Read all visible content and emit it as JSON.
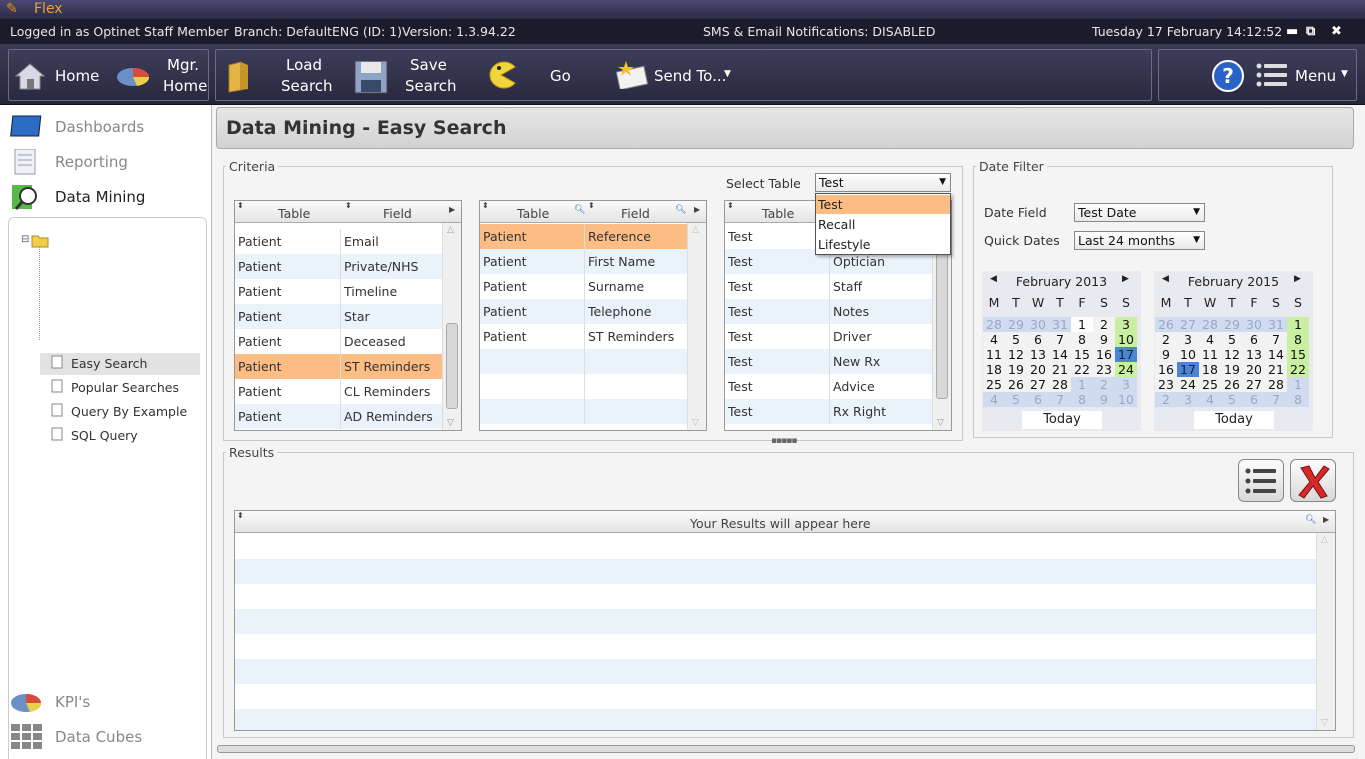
{
  "window": {
    "app_name": "Flex",
    "minimize": "▬",
    "restore": "⧉",
    "close": "✖"
  },
  "status": {
    "logged_in": "Logged in as Optinet Staff Member",
    "branch": "Branch: DefaultENG (ID:  1)",
    "version": "Version: 1.3.94.22",
    "notifications": "SMS & Email Notifications: DISABLED",
    "datetime": "Tuesday 17 February 14:12:52"
  },
  "toolbar": {
    "home": "Home",
    "mgr_home_1": "Mgr.",
    "mgr_home_2": "Home",
    "load_1": "Load",
    "load_2": "Search",
    "save_1": "Save",
    "save_2": "Search",
    "go": "Go",
    "send_to": "Send To...",
    "menu": "Menu"
  },
  "sidebar": {
    "items": [
      {
        "label": "Dashboards"
      },
      {
        "label": "Reporting"
      },
      {
        "label": "Data Mining"
      },
      {
        "label": "KPI's"
      },
      {
        "label": "Data Cubes"
      }
    ],
    "tree": [
      {
        "label": "Easy Search"
      },
      {
        "label": "Popular Searches"
      },
      {
        "label": "Query By Example"
      },
      {
        "label": "SQL Query"
      }
    ]
  },
  "page": {
    "title": "Data Mining - Easy Search"
  },
  "criteria": {
    "legend": "Criteria",
    "select_table_label": "Select Table",
    "select_table_value": "Test",
    "dropdown_options": [
      "Test",
      "Recall",
      "Lifestyle"
    ],
    "grid1": {
      "col_table": "Table",
      "col_field": "Field",
      "rows": [
        {
          "table": "Patient",
          "field": "Email"
        },
        {
          "table": "Patient",
          "field": "Private/NHS"
        },
        {
          "table": "Patient",
          "field": "Timeline"
        },
        {
          "table": "Patient",
          "field": "Star"
        },
        {
          "table": "Patient",
          "field": "Deceased"
        },
        {
          "table": "Patient",
          "field": "ST Reminders"
        },
        {
          "table": "Patient",
          "field": "CL Reminders"
        },
        {
          "table": "Patient",
          "field": "AD Reminders"
        }
      ]
    },
    "grid2": {
      "col_table": "Table",
      "col_field": "Field",
      "rows": [
        {
          "table": "Patient",
          "field": "Reference"
        },
        {
          "table": "Patient",
          "field": "First Name"
        },
        {
          "table": "Patient",
          "field": "Surname"
        },
        {
          "table": "Patient",
          "field": "Telephone"
        },
        {
          "table": "Patient",
          "field": "ST Reminders"
        }
      ]
    },
    "grid3": {
      "col_table": "Table",
      "rows": [
        {
          "table": "Test",
          "field": ""
        },
        {
          "table": "Test",
          "field": "Optician"
        },
        {
          "table": "Test",
          "field": "Staff"
        },
        {
          "table": "Test",
          "field": "Notes"
        },
        {
          "table": "Test",
          "field": "Driver"
        },
        {
          "table": "Test",
          "field": "New Rx"
        },
        {
          "table": "Test",
          "field": "Advice"
        },
        {
          "table": "Test",
          "field": "Rx Right"
        }
      ]
    }
  },
  "date_filter": {
    "legend": "Date Filter",
    "date_field_label": "Date Field",
    "date_field_value": "Test Date",
    "quick_dates_label": "Quick Dates",
    "quick_dates_value": "Last 24 months",
    "cal1": {
      "title": "February 2013",
      "dow": [
        "M",
        "T",
        "W",
        "T",
        "F",
        "S",
        "S"
      ],
      "weeks": [
        [
          "28",
          "29",
          "30",
          "31",
          "1",
          "2",
          "3"
        ],
        [
          "4",
          "5",
          "6",
          "7",
          "8",
          "9",
          "10"
        ],
        [
          "11",
          "12",
          "13",
          "14",
          "15",
          "16",
          "17"
        ],
        [
          "18",
          "19",
          "20",
          "21",
          "22",
          "23",
          "24"
        ],
        [
          "25",
          "26",
          "27",
          "28",
          "1",
          "2",
          "3"
        ],
        [
          "4",
          "5",
          "6",
          "7",
          "8",
          "9",
          "10"
        ]
      ],
      "today": "Today"
    },
    "cal2": {
      "title": "February 2015",
      "dow": [
        "M",
        "T",
        "W",
        "T",
        "F",
        "S",
        "S"
      ],
      "weeks": [
        [
          "26",
          "27",
          "28",
          "29",
          "30",
          "31",
          "1"
        ],
        [
          "2",
          "3",
          "4",
          "5",
          "6",
          "7",
          "8"
        ],
        [
          "9",
          "10",
          "11",
          "12",
          "13",
          "14",
          "15"
        ],
        [
          "16",
          "17",
          "18",
          "19",
          "20",
          "21",
          "22"
        ],
        [
          "23",
          "24",
          "25",
          "26",
          "27",
          "28",
          "1"
        ],
        [
          "2",
          "3",
          "4",
          "5",
          "6",
          "7",
          "8"
        ]
      ],
      "today": "Today"
    }
  },
  "results": {
    "legend": "Results",
    "placeholder": "Your Results will appear here"
  },
  "colors": {
    "selected_row": "#fbbd84",
    "alt_row": "#eaf2fb",
    "sunday": "#c8f0a0",
    "highlight": "#4a86d8"
  }
}
